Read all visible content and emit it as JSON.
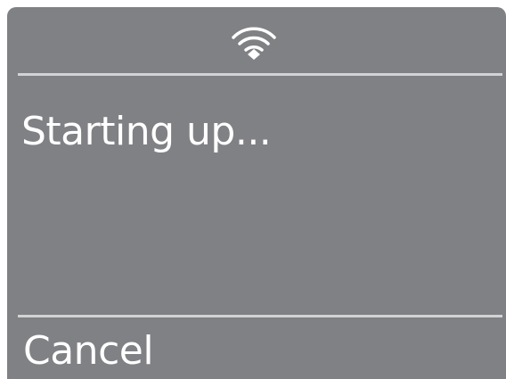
{
  "status_bar": {
    "icon": "wifi-icon"
  },
  "dialog": {
    "message": "Starting up...",
    "cancel_label": "Cancel"
  },
  "colors": {
    "panel_background": "#808184",
    "divider": "#d3d3d5",
    "text": "#ffffff"
  }
}
